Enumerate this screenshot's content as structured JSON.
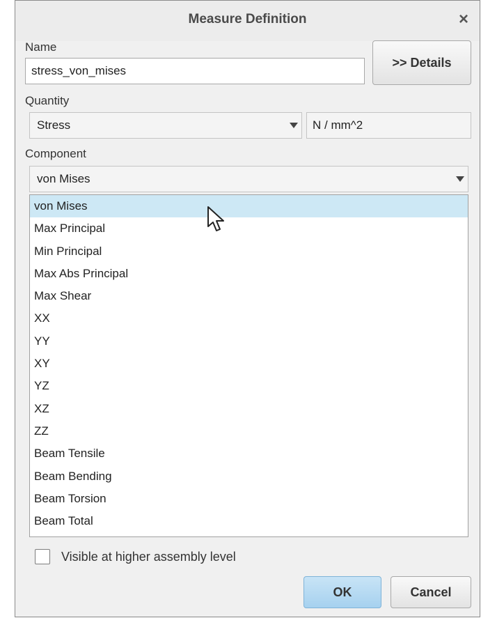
{
  "dialog": {
    "title": "Measure Definition",
    "close_glyph": "×"
  },
  "name": {
    "label": "Name",
    "value": "stress_von_mises"
  },
  "details_button": ">> Details",
  "quantity": {
    "label": "Quantity",
    "selected": "Stress",
    "units": "N / mm^2"
  },
  "component": {
    "label": "Component",
    "selected": "von Mises",
    "options": [
      "von Mises",
      "Max Principal",
      "Min Principal",
      "Max Abs Principal",
      "Max Shear",
      "XX",
      "YY",
      "XY",
      "YZ",
      "XZ",
      "ZZ",
      "Beam Tensile",
      "Beam Bending",
      "Beam Torsion",
      "Beam Total"
    ]
  },
  "visible_higher_level": {
    "label": "Visible at higher assembly level",
    "checked": false
  },
  "buttons": {
    "ok": "OK",
    "cancel": "Cancel"
  },
  "colors": {
    "selection": "#cde8f5",
    "ok_button": "#a6d1ef"
  },
  "icons": {
    "close": "close-icon",
    "dropdown": "chevron-down-icon",
    "cursor": "mouse-pointer-icon"
  }
}
